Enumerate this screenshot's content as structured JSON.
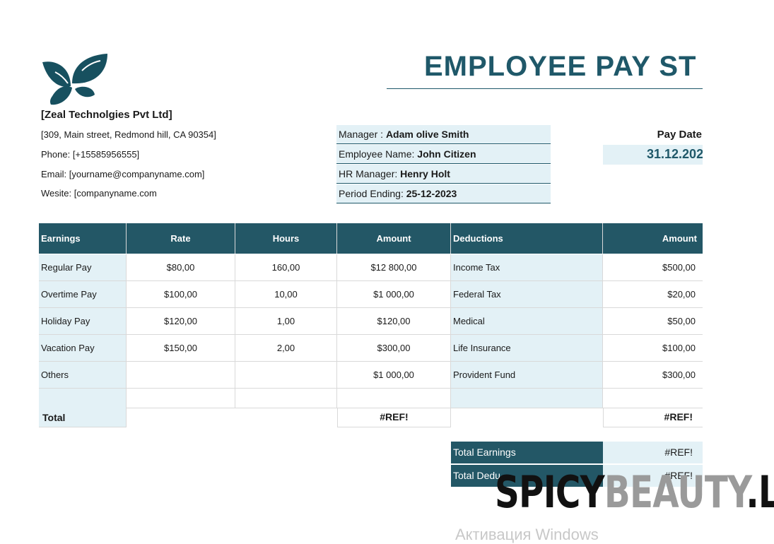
{
  "header": {
    "title": "EMPLOYEE PAY ST",
    "logo_icon": "butterfly-leaf-icon",
    "accent_color": "#1f5869"
  },
  "company": {
    "name": "[Zeal Technolgies Pvt Ltd]",
    "address": "[309, Main street, Redmond hill, CA 90354]",
    "phone": "Phone: [+15585956555]",
    "email": "Email: [yourname@companyname.com]",
    "website": "Wesite: [companyname.com"
  },
  "info": [
    {
      "label": "Manager : ",
      "value": "Adam olive Smith"
    },
    {
      "label": "Employee Name: ",
      "value": "John Citizen"
    },
    {
      "label": "HR Manager: ",
      "value": "Henry Holt"
    },
    {
      "label": "Period Ending: ",
      "value": "25-12-2023"
    }
  ],
  "pay_date": {
    "label": "Pay Date",
    "value": "31.12.202"
  },
  "table": {
    "headers": {
      "earnings": "Earnings",
      "rate": "Rate",
      "hours": "Hours",
      "amount": "Amount",
      "deductions": "Deductions",
      "ded_amount": "Amount"
    },
    "rows": [
      {
        "earning": "Regular Pay",
        "rate": "$80,00",
        "hours": "160,00",
        "amount": "$12 800,00",
        "deduction": "Income Tax",
        "ded_amount": "$500,00"
      },
      {
        "earning": "Overtime Pay",
        "rate": "$100,00",
        "hours": "10,00",
        "amount": "$1 000,00",
        "deduction": "Federal Tax",
        "ded_amount": "$20,00"
      },
      {
        "earning": "Holiday Pay",
        "rate": "$120,00",
        "hours": "1,00",
        "amount": "$120,00",
        "deduction": "Medical",
        "ded_amount": "$50,00"
      },
      {
        "earning": "Vacation Pay",
        "rate": "$150,00",
        "hours": "2,00",
        "amount": "$300,00",
        "deduction": "Life Insurance",
        "ded_amount": "$100,00"
      },
      {
        "earning": "Others",
        "rate": "",
        "hours": "",
        "amount": "$1 000,00",
        "deduction": "Provident Fund",
        "ded_amount": "$300,00"
      },
      {
        "earning": "",
        "rate": "",
        "hours": "",
        "amount": "",
        "deduction": "",
        "ded_amount": ""
      }
    ],
    "total": {
      "label": "Total",
      "amount": "#REF!",
      "ded_amount": "#REF!"
    }
  },
  "summary": {
    "total_earnings_label": "Total Earnings",
    "total_earnings_value": "#REF!",
    "total_deductions_label": "Total Dedu",
    "total_deductions_value": "#REF!"
  },
  "overlay": {
    "watermark_dark_1": "SPICY",
    "watermark_light": "BEAUTY",
    "watermark_dark_2": ".LT",
    "activation": "Активация Windows"
  }
}
